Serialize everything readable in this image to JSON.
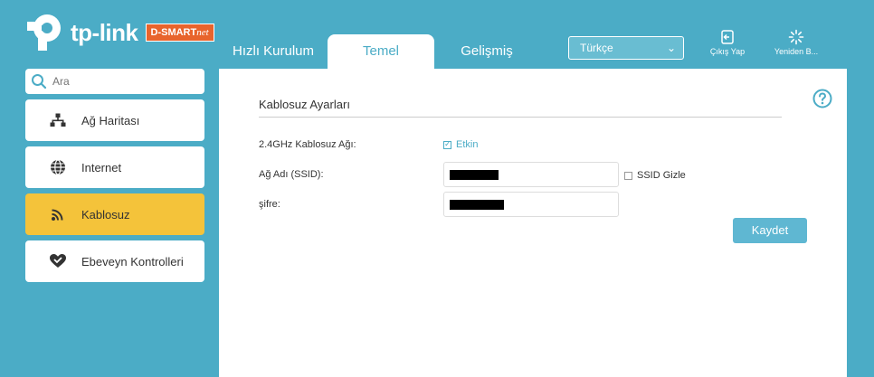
{
  "header": {
    "logo_text": "tp-link",
    "partner_text": "D-SMART",
    "partner_script": "net",
    "tabs": [
      {
        "label": "Hızlı Kurulum"
      },
      {
        "label": "Temel"
      },
      {
        "label": "Gelişmiş"
      }
    ],
    "language": "Türkçe",
    "logout_label": "Çıkış Yap",
    "reboot_label": "Yeniden B..."
  },
  "sidebar": {
    "search_placeholder": "Ara",
    "items": [
      {
        "label": "Ağ Haritası",
        "icon": "network-map-icon"
      },
      {
        "label": "Internet",
        "icon": "globe-icon"
      },
      {
        "label": "Kablosuz",
        "icon": "wireless-icon"
      },
      {
        "label": "Ebeveyn Kontrolleri",
        "icon": "heart-icon"
      }
    ]
  },
  "main": {
    "title": "Kablosuz Ayarları",
    "band_label": "2.4GHz Kablosuz Ağı:",
    "enable_label": "Etkin",
    "ssid_label": "Ağ Adı (SSID):",
    "hide_ssid_label": "SSID Gizle",
    "password_label": "şifre:",
    "save_label": "Kaydet"
  },
  "colors": {
    "accent": "#4bacc6",
    "active_menu": "#f4c33a",
    "save_button": "#5fb7d2",
    "partner_badge": "#e8642c"
  }
}
